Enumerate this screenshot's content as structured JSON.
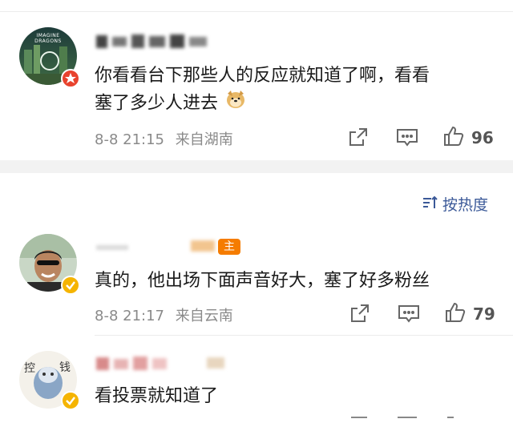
{
  "sort": {
    "label": "按热度"
  },
  "comments": [
    {
      "text_line1": "你看看台下那些人的反应就知道了啊，看看",
      "text_line2": "塞了多少人进去",
      "time": "8-8 21:15",
      "location": "来自湖南",
      "likes": "96",
      "avatar_caption": "IMAGINE DRAGONS"
    },
    {
      "text_line1": "真的，他出场下面声音好大，塞了好多粉丝",
      "time": "8-8 21:17",
      "location": "来自云南",
      "likes": "79"
    },
    {
      "text_line1": "看投票就知道了",
      "avatar_caption": "钱"
    }
  ],
  "colors": {
    "accent_orange": "#f57c00",
    "verified_yellow": "#f5b400",
    "red_badge": "#e8432e",
    "meta_gray": "#8a8a8a",
    "sort_blue": "#3b5998"
  },
  "icons": [
    "share-icon",
    "comment-icon",
    "like-icon",
    "sort-icon",
    "verified-badge-icon",
    "member-badge-icon",
    "doge-emoji-icon"
  ]
}
